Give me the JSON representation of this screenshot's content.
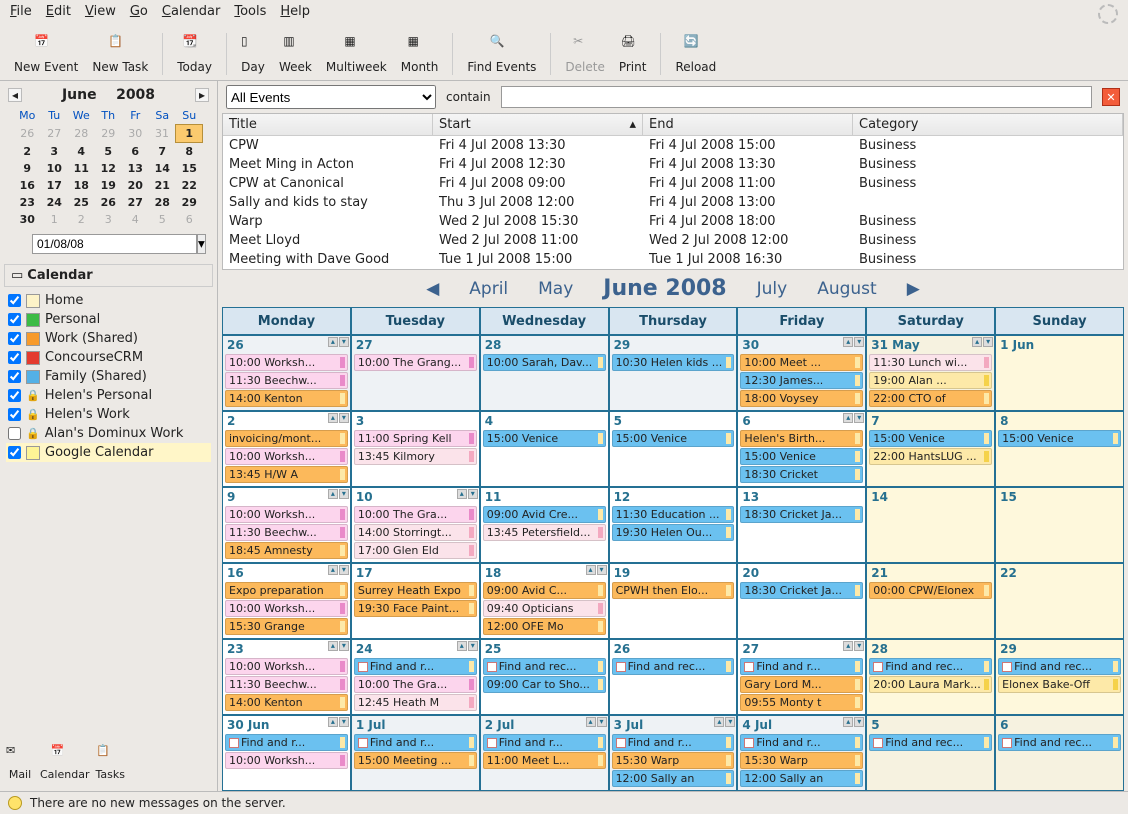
{
  "menu": [
    "File",
    "Edit",
    "View",
    "Go",
    "Calendar",
    "Tools",
    "Help"
  ],
  "toolbar": [
    {
      "label": "New Event"
    },
    {
      "label": "New Task"
    },
    {
      "sep": true
    },
    {
      "label": "Today"
    },
    {
      "sep": true
    },
    {
      "label": "Day"
    },
    {
      "label": "Week"
    },
    {
      "label": "Multiweek"
    },
    {
      "label": "Month"
    },
    {
      "sep": true
    },
    {
      "label": "Find Events"
    },
    {
      "sep": true
    },
    {
      "label": "Delete",
      "disabled": true
    },
    {
      "label": "Print"
    },
    {
      "sep": true
    },
    {
      "label": "Reload"
    }
  ],
  "mini": {
    "month": "June",
    "year": "2008",
    "dow": [
      "Mo",
      "Tu",
      "We",
      "Th",
      "Fr",
      "Sa",
      "Su"
    ]
  },
  "dateValue": "01/08/08",
  "sidebarTitle": "Calendar",
  "calendars": [
    {
      "name": "Home",
      "color": "#fdf3c8",
      "checked": true
    },
    {
      "name": "Personal",
      "color": "#3dbb46",
      "checked": true
    },
    {
      "name": "Work (Shared)",
      "color": "#f79a2b",
      "checked": true
    },
    {
      "name": "ConcourseCRM",
      "color": "#e43b2e",
      "checked": true
    },
    {
      "name": "Family (Shared)",
      "color": "#53b0e6",
      "checked": true
    },
    {
      "name": "Helen's Personal",
      "color": "#fff",
      "checked": true,
      "locked": true
    },
    {
      "name": "Helen's Work",
      "color": "#fff",
      "checked": true,
      "locked": true
    },
    {
      "name": "Alan's Dominux Work",
      "color": "#fff",
      "checked": false,
      "locked": true
    },
    {
      "name": "Google Calendar",
      "color": "#fdf496",
      "checked": true,
      "hl": true
    }
  ],
  "footer": [
    {
      "label": "Mail"
    },
    {
      "label": "Calendar"
    },
    {
      "label": "Tasks"
    }
  ],
  "search": {
    "filter": "All Events",
    "label": "contain"
  },
  "elcols": [
    "Title",
    "Start",
    "End",
    "Category"
  ],
  "events": [
    {
      "t": "CPW",
      "s": "Fri 4 Jul 2008 13:30",
      "e": "Fri 4 Jul 2008 15:00",
      "c": "Business"
    },
    {
      "t": "Meet Ming in Acton",
      "s": "Fri 4 Jul 2008 12:30",
      "e": "Fri 4 Jul 2008 13:30",
      "c": "Business"
    },
    {
      "t": "CPW at Canonical",
      "s": "Fri 4 Jul 2008 09:00",
      "e": "Fri 4 Jul 2008 11:00",
      "c": "Business"
    },
    {
      "t": "Sally and kids to stay",
      "s": "Thu 3 Jul 2008 12:00",
      "e": "Fri 4 Jul 2008 13:00",
      "c": ""
    },
    {
      "t": "Warp",
      "s": "Wed 2 Jul 2008 15:30",
      "e": "Fri 4 Jul 2008 18:00",
      "c": "Business"
    },
    {
      "t": "Meet Lloyd",
      "s": "Wed 2 Jul 2008 11:00",
      "e": "Wed 2 Jul 2008 12:00",
      "c": "Business"
    },
    {
      "t": "Meeting with Dave Good",
      "s": "Tue 1 Jul 2008 15:00",
      "e": "Tue 1 Jul 2008 16:30",
      "c": "Business"
    }
  ],
  "nav": {
    "p2": "April",
    "p1": "May",
    "cur": "June 2008",
    "n1": "July",
    "n2": "August"
  },
  "daynames": [
    "Monday",
    "Tuesday",
    "Wednesday",
    "Thursday",
    "Friday",
    "Saturday",
    "Sunday"
  ],
  "weeks": [
    [
      {
        "n": "26",
        "oom": true,
        "sc": true,
        "ev": [
          {
            "c": "pink",
            "t": "10:00 Worksh..."
          },
          {
            "c": "pink",
            "t": "11:30 Beechw..."
          },
          {
            "c": "orange",
            "t": "14:00 Kenton"
          }
        ]
      },
      {
        "n": "27",
        "oom": true,
        "ev": [
          {
            "c": "pink",
            "t": "10:00 The Grang..."
          }
        ]
      },
      {
        "n": "28",
        "oom": true,
        "ev": [
          {
            "c": "blue",
            "t": "10:00 Sarah, Dav..."
          }
        ]
      },
      {
        "n": "29",
        "oom": true,
        "ev": [
          {
            "c": "blue",
            "t": "10:30 Helen kids ..."
          }
        ]
      },
      {
        "n": "30",
        "oom": true,
        "sc": true,
        "ev": [
          {
            "c": "orange",
            "t": "10:00 Meet ..."
          },
          {
            "c": "blue",
            "t": "12:30 James..."
          },
          {
            "c": "orange",
            "t": "18:00 Voysey"
          }
        ]
      },
      {
        "n": "31 May",
        "oom": true,
        "we": true,
        "sc": true,
        "ev": [
          {
            "c": "ltpink",
            "t": "11:30 Lunch wi..."
          },
          {
            "c": "yellow",
            "t": "19:00 Alan ..."
          },
          {
            "c": "orange",
            "t": "22:00 CTO of"
          }
        ]
      },
      {
        "n": "1 Jun",
        "we": true,
        "ev": []
      }
    ],
    [
      {
        "n": "2",
        "sc": true,
        "ev": [
          {
            "c": "orange",
            "t": "invoicing/mont..."
          },
          {
            "c": "pink",
            "t": "10:00 Worksh..."
          },
          {
            "c": "orange",
            "t": "13:45 H/W A"
          }
        ]
      },
      {
        "n": "3",
        "ev": [
          {
            "c": "pink",
            "t": "11:00 Spring Kell"
          },
          {
            "c": "ltpink",
            "t": "13:45 Kilmory"
          }
        ]
      },
      {
        "n": "4",
        "ev": [
          {
            "c": "blue",
            "t": "15:00 Venice"
          }
        ]
      },
      {
        "n": "5",
        "ev": [
          {
            "c": "blue",
            "t": "15:00 Venice"
          }
        ]
      },
      {
        "n": "6",
        "sc": true,
        "ev": [
          {
            "c": "orange",
            "t": "Helen's Birth..."
          },
          {
            "c": "blue",
            "t": "15:00 Venice"
          },
          {
            "c": "blue",
            "t": "18:30 Cricket"
          }
        ]
      },
      {
        "n": "7",
        "we": true,
        "ev": [
          {
            "c": "blue",
            "t": "15:00 Venice"
          },
          {
            "c": "yellow",
            "t": "22:00 HantsLUG ..."
          }
        ]
      },
      {
        "n": "8",
        "we": true,
        "ev": [
          {
            "c": "blue",
            "t": "15:00 Venice"
          }
        ]
      }
    ],
    [
      {
        "n": "9",
        "sc": true,
        "ev": [
          {
            "c": "pink",
            "t": "10:00 Worksh..."
          },
          {
            "c": "pink",
            "t": "11:30 Beechw..."
          },
          {
            "c": "orange",
            "t": "18:45 Amnesty"
          }
        ]
      },
      {
        "n": "10",
        "sc": true,
        "ev": [
          {
            "c": "pink",
            "t": "10:00 The Gra..."
          },
          {
            "c": "ltpink",
            "t": "14:00 Storringt..."
          },
          {
            "c": "ltpink",
            "t": "17:00 Glen Eld"
          }
        ]
      },
      {
        "n": "11",
        "ev": [
          {
            "c": "blue",
            "t": "09:00 Avid Cre..."
          },
          {
            "c": "ltpink",
            "t": "13:45 Petersfield..."
          }
        ]
      },
      {
        "n": "12",
        "ev": [
          {
            "c": "blue",
            "t": "11:30 Education ..."
          },
          {
            "c": "blue",
            "t": "19:30 Helen Ou..."
          }
        ]
      },
      {
        "n": "13",
        "ev": [
          {
            "c": "blue",
            "t": "18:30 Cricket Ja..."
          }
        ]
      },
      {
        "n": "14",
        "we": true,
        "ev": []
      },
      {
        "n": "15",
        "we": true,
        "ev": []
      }
    ],
    [
      {
        "n": "16",
        "sc": true,
        "ev": [
          {
            "c": "orange",
            "t": "Expo preparation"
          },
          {
            "c": "pink",
            "t": "10:00 Worksh..."
          },
          {
            "c": "orange",
            "t": "15:30 Grange"
          }
        ]
      },
      {
        "n": "17",
        "ev": [
          {
            "c": "orange",
            "t": "Surrey Heath Expo"
          },
          {
            "c": "orange",
            "t": "19:30 Face Paint..."
          }
        ]
      },
      {
        "n": "18",
        "sc": true,
        "ev": [
          {
            "c": "orange",
            "t": "09:00 Avid C..."
          },
          {
            "c": "ltpink",
            "t": "09:40 Opticians"
          },
          {
            "c": "orange",
            "t": "12:00 OFE Mo"
          }
        ]
      },
      {
        "n": "19",
        "ev": [
          {
            "c": "orange",
            "t": "CPWH then Elo..."
          }
        ]
      },
      {
        "n": "20",
        "ev": [
          {
            "c": "blue",
            "t": "18:30 Cricket Ja..."
          }
        ]
      },
      {
        "n": "21",
        "we": true,
        "ev": [
          {
            "c": "orange",
            "t": "00:00 CPW/Elonex"
          }
        ]
      },
      {
        "n": "22",
        "we": true,
        "ev": []
      }
    ],
    [
      {
        "n": "23",
        "sc": true,
        "ev": [
          {
            "c": "pink",
            "t": "10:00 Worksh..."
          },
          {
            "c": "pink",
            "t": "11:30 Beechw..."
          },
          {
            "c": "orange",
            "t": "14:00 Kenton"
          }
        ]
      },
      {
        "n": "24",
        "sc": true,
        "ev": [
          {
            "c": "blue",
            "t": "Find and r...",
            "r": true
          },
          {
            "c": "pink",
            "t": "10:00 The Gra..."
          },
          {
            "c": "ltpink",
            "t": "12:45 Heath M"
          }
        ]
      },
      {
        "n": "25",
        "ev": [
          {
            "c": "blue",
            "t": "Find and rec...",
            "r": true
          },
          {
            "c": "blue",
            "t": "09:00 Car to Sho..."
          }
        ]
      },
      {
        "n": "26",
        "ev": [
          {
            "c": "blue",
            "t": "Find and rec...",
            "r": true
          }
        ]
      },
      {
        "n": "27",
        "sc": true,
        "ev": [
          {
            "c": "blue",
            "t": "Find and r...",
            "r": true
          },
          {
            "c": "orange",
            "t": "Gary Lord M..."
          },
          {
            "c": "orange",
            "t": "09:55 Monty t"
          }
        ]
      },
      {
        "n": "28",
        "we": true,
        "ev": [
          {
            "c": "blue",
            "t": "Find and rec...",
            "r": true
          },
          {
            "c": "yellow",
            "t": "20:00 Laura Mark..."
          }
        ]
      },
      {
        "n": "29",
        "we": true,
        "ev": [
          {
            "c": "blue",
            "t": "Find and rec...",
            "r": true
          },
          {
            "c": "yellow",
            "t": "Elonex Bake-Off"
          }
        ]
      }
    ],
    [
      {
        "n": "30 Jun",
        "sc": true,
        "ev": [
          {
            "c": "blue",
            "t": "Find and r...",
            "r": true
          },
          {
            "c": "pink",
            "t": "10:00 Worksh..."
          }
        ]
      },
      {
        "n": "1 Jul",
        "oom": true,
        "ev": [
          {
            "c": "blue",
            "t": "Find and r...",
            "r": true
          },
          {
            "c": "orange",
            "t": "15:00 Meeting ..."
          }
        ]
      },
      {
        "n": "2 Jul",
        "oom": true,
        "sc": true,
        "ev": [
          {
            "c": "blue",
            "t": "Find and r...",
            "r": true
          },
          {
            "c": "orange",
            "t": "11:00 Meet L..."
          }
        ]
      },
      {
        "n": "3 Jul",
        "oom": true,
        "sc": true,
        "ev": [
          {
            "c": "blue",
            "t": "Find and r...",
            "r": true
          },
          {
            "c": "orange",
            "t": "15:30 Warp"
          },
          {
            "c": "blue",
            "t": "12:00 Sally an"
          }
        ]
      },
      {
        "n": "4 Jul",
        "oom": true,
        "sc": true,
        "ev": [
          {
            "c": "blue",
            "t": "Find and r...",
            "r": true
          },
          {
            "c": "orange",
            "t": "15:30 Warp"
          },
          {
            "c": "blue",
            "t": "12:00 Sally an"
          }
        ]
      },
      {
        "n": "5",
        "oom": true,
        "we": true,
        "ev": [
          {
            "c": "blue",
            "t": "Find and rec...",
            "r": true
          }
        ]
      },
      {
        "n": "6",
        "oom": true,
        "we": true,
        "ev": [
          {
            "c": "blue",
            "t": "Find and rec...",
            "r": true
          }
        ]
      }
    ]
  ],
  "status": "There are no new messages on the server."
}
